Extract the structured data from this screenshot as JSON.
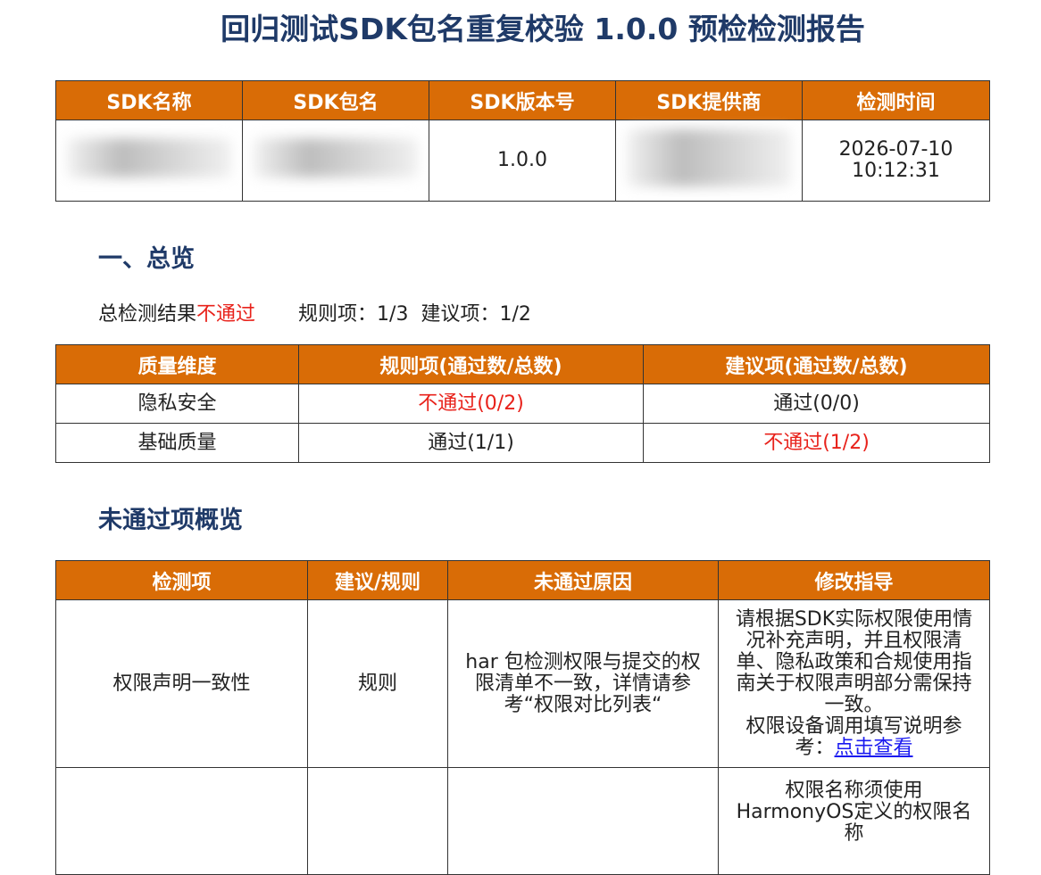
{
  "report_title": "回归测试SDK包名重复校验 1.0.0 预检检测报告",
  "info_table": {
    "headers": [
      "SDK名称",
      "SDK包名",
      "SDK版本号",
      "SDK提供商",
      "检测时间"
    ],
    "version": "1.0.0",
    "time_date": "2026-07-10",
    "time_clock": "10:12:31"
  },
  "overview": {
    "heading": "一、总览",
    "result_label": "总检测结果",
    "result_value": "不通过",
    "rule_text": "规则项：1/3",
    "suggest_text": "建议项：1/2"
  },
  "quality_table": {
    "headers": [
      "质量维度",
      "规则项(通过数/总数)",
      "建议项(通过数/总数)"
    ],
    "rows": [
      {
        "dimension": "隐私安全",
        "rule": "不通过(0/2)",
        "suggest": "通过(0/0)"
      },
      {
        "dimension": "基础质量",
        "rule": "通过(1/1)",
        "suggest": "不通过(1/2)"
      }
    ]
  },
  "failed_overview": {
    "heading": "未通过项概览",
    "headers": [
      "检测项",
      "建议/规则",
      "未通过原因",
      "修改指导"
    ],
    "rows": [
      {
        "item": "权限声明一致性",
        "type": "规则",
        "reason": "har 包检测权限与提交的权限清单不一致，详情请参考“权限对比列表“",
        "guide": "请根据SDK实际权限使用情况补充声明，并且权限清单、隐私政策和合规使用指南关于权限声明部分需保持一致。",
        "guide_extra": "权限设备调用填写说明参考：",
        "link": "点击查看"
      },
      {
        "item": "",
        "type": "",
        "reason": "",
        "guide": "权限名称须使用HarmonyOS定义的权限名称"
      }
    ]
  }
}
